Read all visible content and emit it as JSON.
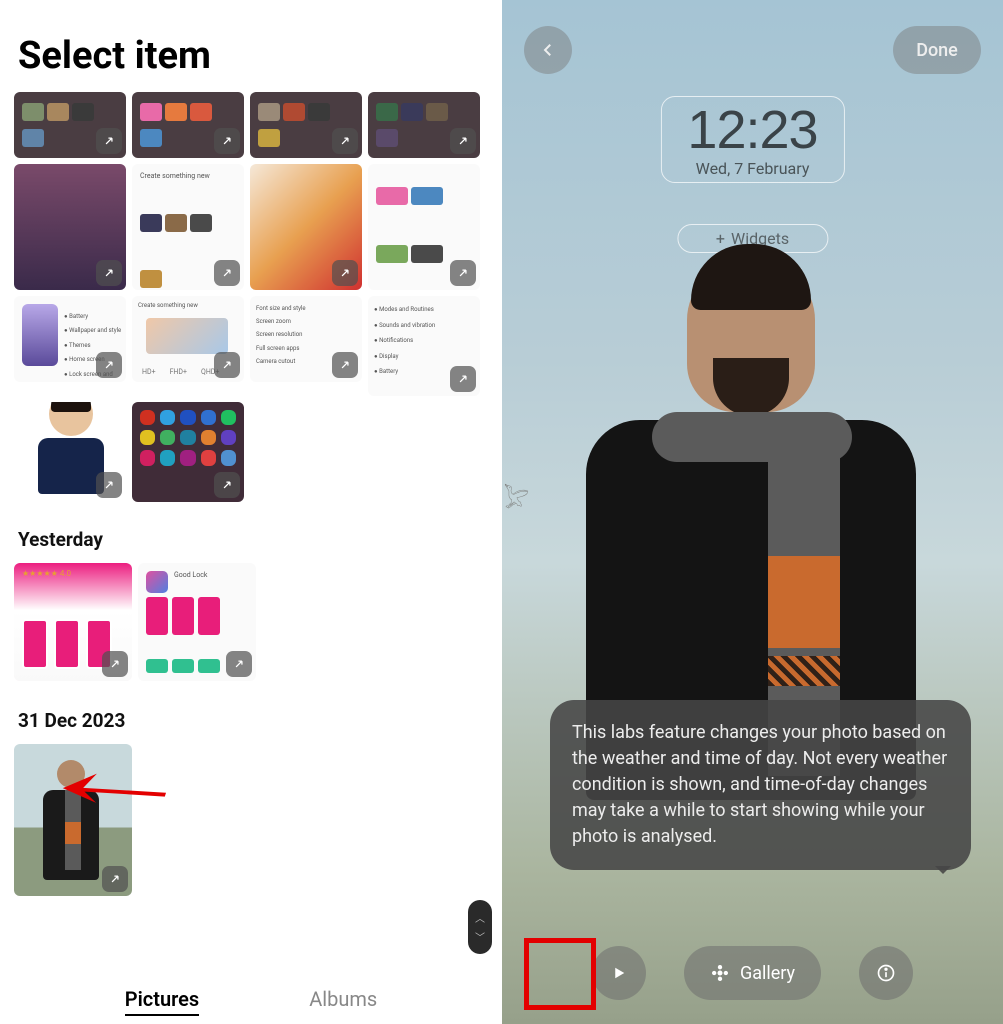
{
  "left": {
    "title": "Select item",
    "sections": {
      "yesterday": "Yesterday",
      "dec": "31 Dec 2023"
    },
    "tabs": {
      "pictures": "Pictures",
      "albums": "Albums"
    }
  },
  "right": {
    "done": "Done",
    "clock": {
      "time": "12:23",
      "date": "Wed, 7 February"
    },
    "widgets_label": "Widgets",
    "tooltip": "This labs feature changes your photo based on the weather and time of day. Not every weather condition is shown, and time-of-day changes may take a while to start showing while your photo is analysed.",
    "gallery_label": "Gallery"
  },
  "colors": {
    "highlight_red": "#e30000",
    "arrow_red": "#e30000"
  }
}
